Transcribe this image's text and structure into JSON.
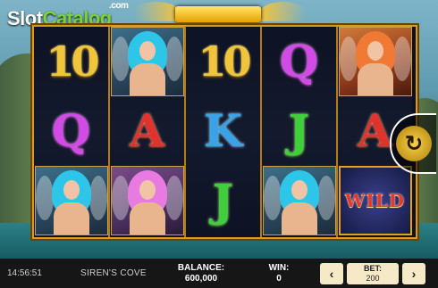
{
  "logo": {
    "part1": "Slot",
    "part2": "Catalog",
    "com": ".com"
  },
  "reels": [
    [
      {
        "type": "letter",
        "text": "10",
        "color": "c-ten"
      },
      {
        "type": "letter",
        "text": "Q",
        "color": "c-q"
      },
      {
        "type": "portrait",
        "variant": "p-blue",
        "name": "blue-siren"
      }
    ],
    [
      {
        "type": "portrait",
        "variant": "p-blue",
        "name": "blue-siren"
      },
      {
        "type": "letter",
        "text": "A",
        "color": "c-a"
      },
      {
        "type": "portrait",
        "variant": "p-pink",
        "name": "pink-siren"
      }
    ],
    [
      {
        "type": "letter",
        "text": "10",
        "color": "c-ten"
      },
      {
        "type": "letter",
        "text": "K",
        "color": "c-k"
      },
      {
        "type": "letter",
        "text": "J",
        "color": "c-j"
      }
    ],
    [
      {
        "type": "letter",
        "text": "Q",
        "color": "c-q"
      },
      {
        "type": "letter",
        "text": "J",
        "color": "c-j"
      },
      {
        "type": "portrait",
        "variant": "p-blue",
        "name": "blue-siren"
      }
    ],
    [
      {
        "type": "portrait",
        "variant": "p-orange",
        "name": "orange-siren"
      },
      {
        "type": "letter",
        "text": "A",
        "color": "c-a"
      },
      {
        "type": "wild",
        "text": "WILD"
      }
    ]
  ],
  "spin": {
    "icon": "spin-icon",
    "glyph": "↻"
  },
  "bottom": {
    "time": "14:56:51",
    "game_name": "SIREN'S COVE",
    "balance_label": "BALANCE:",
    "balance_value": "600,000",
    "win_label": "WIN:",
    "win_value": "0",
    "bet_label": "BET:",
    "bet_value": "200",
    "bet_down": "‹",
    "bet_up": "›"
  }
}
